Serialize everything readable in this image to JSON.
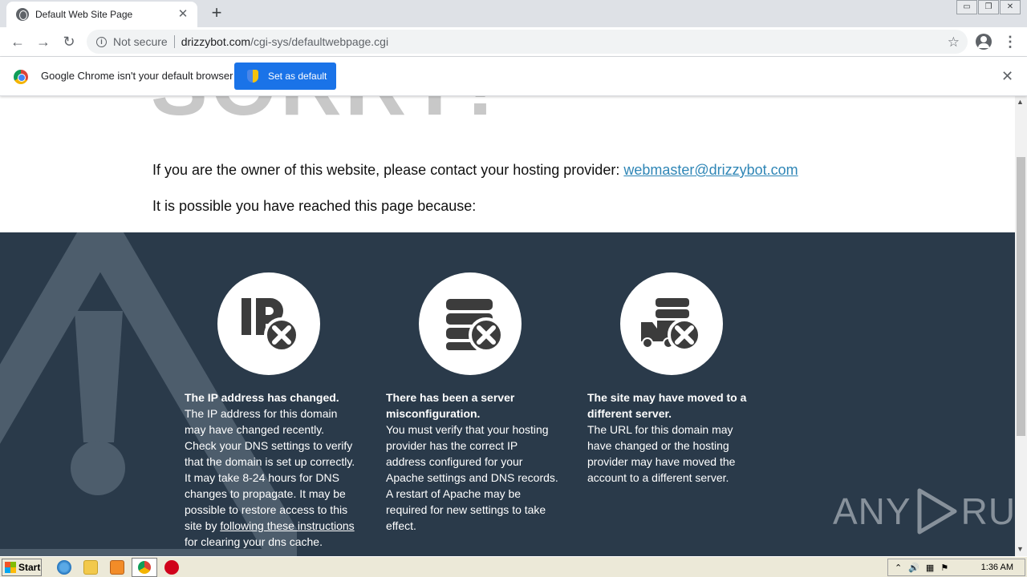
{
  "browser": {
    "tab_title": "Default Web Site Page",
    "address": {
      "security_label": "Not secure",
      "host": "drizzybot.com",
      "path": "/cgi-sys/defaultwebpage.cgi"
    },
    "infobar": {
      "message": "Google Chrome isn't your default browser",
      "button_label": "Set as default"
    }
  },
  "page": {
    "heading": "SORRY!",
    "owner_text": "If you are the owner of this website, please contact your hosting provider: ",
    "owner_email": "webmaster@drizzybot.com",
    "reason_intro": "It is possible you have reached this page because:",
    "reasons": [
      {
        "icon": "ip-error-icon",
        "title": "The IP address has changed.",
        "body": "The IP address for this domain may have changed recently. Check your DNS settings to verify that the domain is set up correctly. It may take 8-24 hours for DNS changes to propagate. It may be possible to restore access to this site by ",
        "link": "following these instructions",
        "body_after": " for clearing your dns cache."
      },
      {
        "icon": "server-error-icon",
        "title": "There has been a server misconfiguration.",
        "body": "You must verify that your hosting provider has the correct IP address configured for your Apache settings and DNS records. A restart of Apache may be required for new settings to take effect."
      },
      {
        "icon": "server-moved-icon",
        "title": "The site may have moved to a different server.",
        "body": "The URL for this domain may have changed or the hosting provider may have moved the account to a different server."
      }
    ],
    "watermark_left": "ANY",
    "watermark_right": "RUN"
  },
  "taskbar": {
    "start_label": "Start",
    "clock": "1:36 AM"
  },
  "colors": {
    "dark_section": "#2a3a4a",
    "link": "#2f86b6",
    "accent_button": "#1a73e8"
  }
}
